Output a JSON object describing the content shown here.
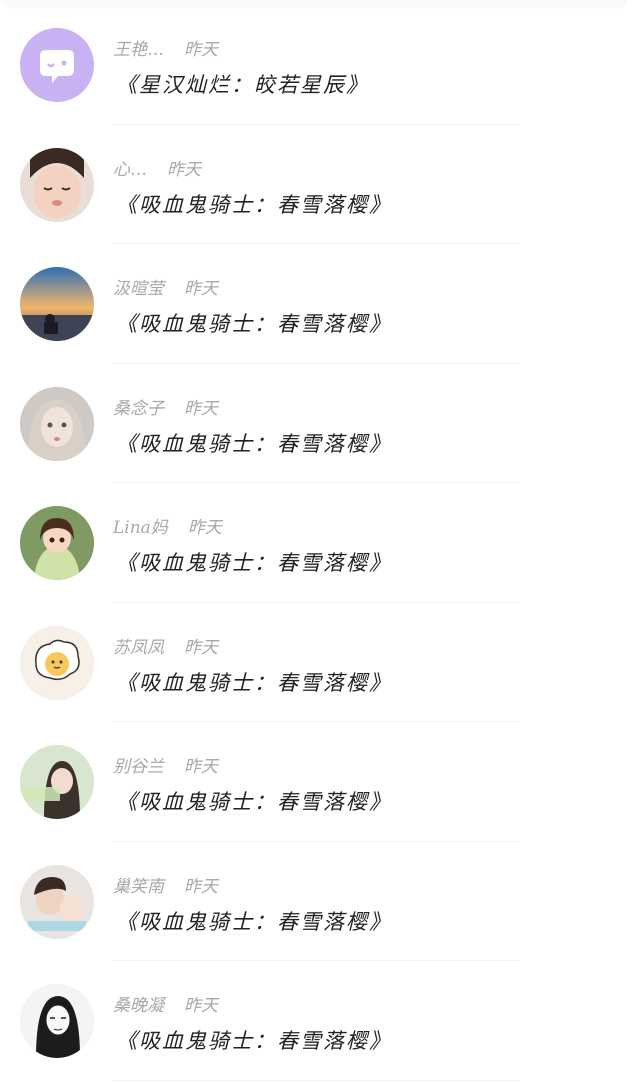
{
  "items": [
    {
      "name": "王艳…",
      "time": "昨天",
      "title": "《星汉灿烂：皎若星辰》",
      "avatar": "chat-bubble-avatar"
    },
    {
      "name": "心…",
      "time": "昨天",
      "title": "《吸血鬼骑士：春雪落樱》",
      "avatar": "child-photo-avatar"
    },
    {
      "name": "汲暄莹",
      "time": "昨天",
      "title": "《吸血鬼骑士：春雪落樱》",
      "avatar": "sunset-beach-avatar"
    },
    {
      "name": "桑念子",
      "time": "昨天",
      "title": "《吸血鬼骑士：春雪落樱》",
      "avatar": "doll-girl-avatar"
    },
    {
      "name": "Lina妈",
      "time": "昨天",
      "title": "《吸血鬼骑士：春雪落樱》",
      "avatar": "cartoon-girl-avatar"
    },
    {
      "name": "苏凤凤",
      "time": "昨天",
      "title": "《吸血鬼骑士：春雪落樱》",
      "avatar": "egg-cartoon-avatar"
    },
    {
      "name": "别谷兰",
      "time": "昨天",
      "title": "《吸血鬼骑士：春雪落樱》",
      "avatar": "girl-photo-avatar"
    },
    {
      "name": "巢笑南",
      "time": "昨天",
      "title": "《吸血鬼骑士：春雪落樱》",
      "avatar": "couple-photo-avatar"
    },
    {
      "name": "桑晚凝",
      "time": "昨天",
      "title": "《吸血鬼骑士：春雪落樱》",
      "avatar": "sketch-woman-avatar"
    }
  ]
}
